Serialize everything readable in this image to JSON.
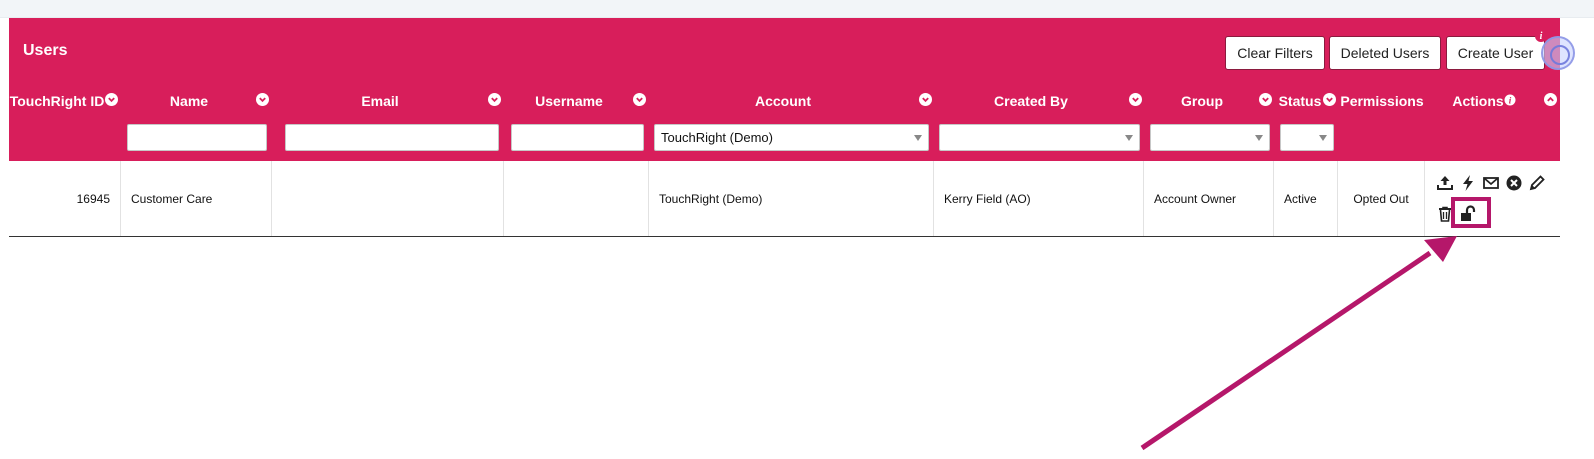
{
  "header": {
    "title": "Users",
    "buttons": [
      "Clear Filters",
      "Deleted Users",
      "Create User"
    ],
    "info_badge": "i"
  },
  "columns": {
    "id": "TouchRight ID",
    "name": "Name",
    "email": "Email",
    "username": "Username",
    "account": "Account",
    "created_by": "Created By",
    "group": "Group",
    "status": "Status",
    "permissions": "Permissions",
    "actions": "Actions"
  },
  "filters": {
    "account_selected": "TouchRight (Demo)"
  },
  "row": {
    "id": "16945",
    "name": "Customer Care",
    "email": "",
    "username": "",
    "account": "TouchRight (Demo)",
    "created_by": "Kerry Field (AO)",
    "group": "Account Owner",
    "status": "Active",
    "permissions": "Opted Out",
    "action_icons": [
      "upload-icon",
      "bolt-icon",
      "envelope-icon",
      "close-circle-icon",
      "pencil-icon",
      "trash-icon",
      "unlock-icon"
    ]
  },
  "colors": {
    "header_bg": "#d81e5b",
    "highlight": "#b5176a"
  }
}
